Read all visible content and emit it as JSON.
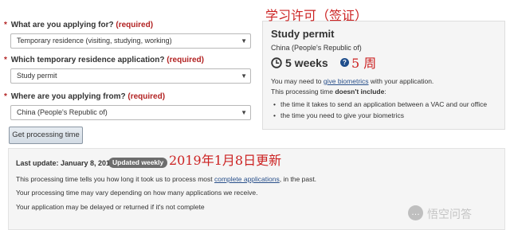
{
  "form": {
    "q1": {
      "label": "What are you applying for?",
      "required": "(required)",
      "value": "Temporary residence (visiting, studying, working)"
    },
    "q2": {
      "label": "Which temporary residence application?",
      "required": "(required)",
      "value": "Study permit"
    },
    "q3": {
      "label": "Where are you applying from?",
      "required": "(required)",
      "value": "China (People's Republic of)"
    },
    "required_star": "*",
    "submit_label": "Get processing time"
  },
  "result": {
    "title": "Study permit",
    "country": "China (People's Republic of)",
    "duration": "5 weeks",
    "help_icon": "question-circle-icon",
    "clock_icon": "clock-icon",
    "line1_pre": "You may need to ",
    "line1_link": "give biometrics",
    "line1_post": " with your application.",
    "line2_pre": "This processing time ",
    "line2_bold": "doesn't include",
    "line2_post": ":",
    "bullets": [
      "the time it takes to send an application between a VAC and our office",
      "the time you need to give your biometrics"
    ]
  },
  "update": {
    "last_update": "Last update: January 8, 2019",
    "badge": "Updated weekly",
    "line1_pre": "This processing time tells you how long it took us to process most ",
    "line1_link": "complete applications",
    "line1_post": ", in the past.",
    "line2": "Your processing time may vary depending on how many applications we receive.",
    "line3": "Your application may be delayed or returned if it's not complete"
  },
  "annotations": {
    "top": "学习许可（签证）",
    "week": "5  周",
    "date": "2019年1月8日更新"
  },
  "watermark": {
    "icon": "speech-bubble-icon",
    "text": "悟空问答"
  },
  "colors": {
    "required_red": "#b22222",
    "annotation_red": "#cc2222",
    "link_blue": "#284f8a",
    "badge_gray": "#6d6d6d",
    "panel_bg": "#f5f5f5"
  }
}
